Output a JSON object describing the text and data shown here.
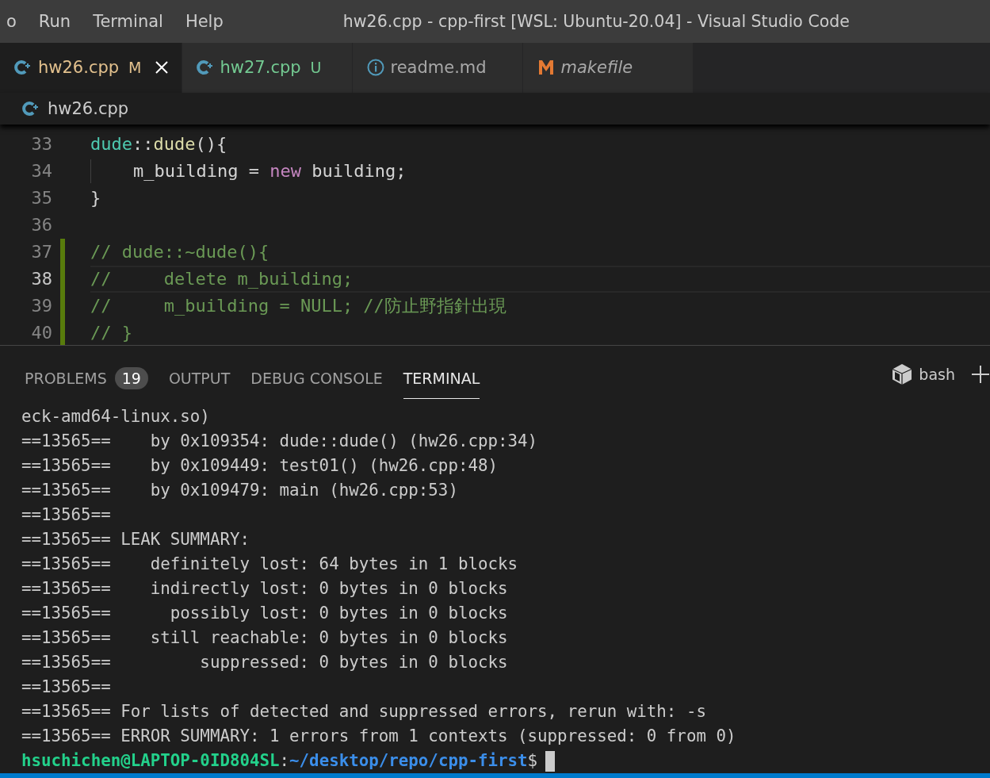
{
  "menu": [
    "o",
    "Run",
    "Terminal",
    "Help"
  ],
  "window": {
    "title": "hw26.cpp - cpp-first [WSL: Ubuntu-20.04] - Visual Studio Code"
  },
  "tabs": [
    {
      "label": "hw26.cpp",
      "kind": "cpp",
      "status": "M",
      "color": "#e2c08d",
      "selected": true,
      "italic": false
    },
    {
      "label": "hw27.cpp",
      "kind": "cpp",
      "status": "U",
      "color": "#73c991",
      "selected": false,
      "italic": false
    },
    {
      "label": "readme.md",
      "kind": "info",
      "color": "#a8a8a8",
      "selected": false,
      "italic": false
    },
    {
      "label": "makefile",
      "kind": "make",
      "color": "#a8a8a8",
      "selected": false,
      "italic": true
    }
  ],
  "breadcrumb": {
    "label": "hw26.cpp"
  },
  "editor": {
    "lines": [
      {
        "number": "33",
        "changed": false,
        "current": false,
        "guide": false,
        "tokens": [
          {
            "kind": "type",
            "text": "dude"
          },
          {
            "kind": "plain",
            "text": "::"
          },
          {
            "kind": "func",
            "text": "dude"
          },
          {
            "kind": "plain",
            "text": "(){"
          }
        ]
      },
      {
        "number": "34",
        "changed": false,
        "current": false,
        "guide": true,
        "tokens": [
          {
            "kind": "plain",
            "text": "    m_building = "
          },
          {
            "kind": "keyword",
            "text": "new"
          },
          {
            "kind": "plain",
            "text": " building;"
          }
        ]
      },
      {
        "number": "35",
        "changed": false,
        "current": false,
        "guide": false,
        "tokens": [
          {
            "kind": "plain",
            "text": "}"
          }
        ]
      },
      {
        "number": "36",
        "changed": false,
        "current": false,
        "guide": false
      },
      {
        "number": "37",
        "changed": true,
        "current": false,
        "guide": false,
        "tokens": [
          {
            "kind": "comment",
            "text": "// dude::~dude(){"
          }
        ]
      },
      {
        "number": "38",
        "changed": true,
        "current": true,
        "guide": false,
        "tokens": [
          {
            "kind": "comment",
            "text": "//     delete m_building;"
          }
        ]
      },
      {
        "number": "39",
        "changed": true,
        "current": false,
        "guide": false,
        "tokens": [
          {
            "kind": "comment",
            "text": "//     m_building = NULL; //防止野指針出現"
          }
        ]
      },
      {
        "number": "40",
        "changed": true,
        "current": false,
        "guide": false,
        "tokens": [
          {
            "kind": "comment",
            "text": "// }"
          }
        ]
      }
    ]
  },
  "panel": {
    "tabs": [
      {
        "label": "PROBLEMS",
        "badge": "19",
        "selected": false
      },
      {
        "label": "OUTPUT",
        "selected": false
      },
      {
        "label": "DEBUG CONSOLE",
        "selected": false
      },
      {
        "label": "TERMINAL",
        "selected": true
      }
    ],
    "shell": "bash"
  },
  "terminal": {
    "lines": [
      "eck-amd64-linux.so)",
      "==13565==    by 0x109354: dude::dude() (hw26.cpp:34)",
      "==13565==    by 0x109449: test01() (hw26.cpp:48)",
      "==13565==    by 0x109479: main (hw26.cpp:53)",
      "==13565==",
      "==13565== LEAK SUMMARY:",
      "==13565==    definitely lost: 64 bytes in 1 blocks",
      "==13565==    indirectly lost: 0 bytes in 0 blocks",
      "==13565==      possibly lost: 0 bytes in 0 blocks",
      "==13565==    still reachable: 0 bytes in 0 blocks",
      "==13565==         suppressed: 0 bytes in 0 blocks",
      "==13565==",
      "==13565== For lists of detected and suppressed errors, rerun with: -s",
      "==13565== ERROR SUMMARY: 1 errors from 1 contexts (suppressed: 0 from 0)"
    ],
    "prompt": {
      "user": "hsuchichen@LAPTOP-0ID804SL",
      "separator": ":",
      "path": "~/desktop/repo/cpp-first",
      "symbol": "$"
    }
  }
}
